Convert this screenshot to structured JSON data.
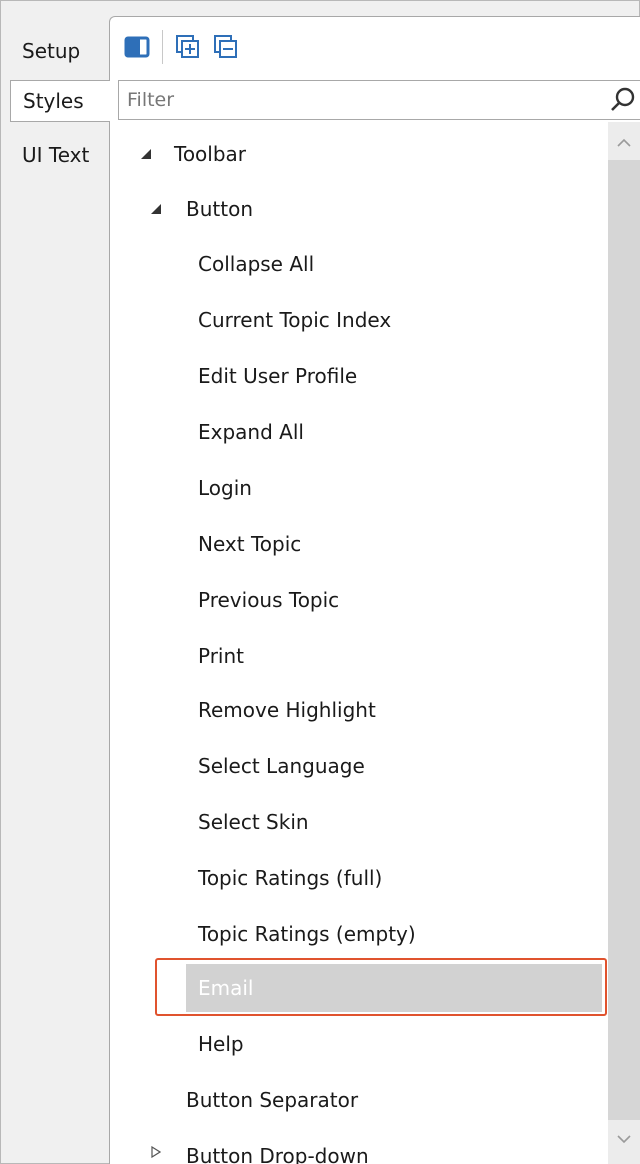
{
  "tabs": {
    "setup": "Setup",
    "styles": "Styles",
    "ui_text": "UI Text"
  },
  "toolbar": {
    "icons": [
      "panel-toggle-icon",
      "expand-all-icon",
      "collapse-all-icon"
    ]
  },
  "filter": {
    "placeholder": "Filter"
  },
  "tree": {
    "toolbar": "Toolbar",
    "button": "Button",
    "items": [
      "Collapse All",
      "Current Topic Index",
      "Edit User Profile",
      "Expand All",
      "Login",
      "Next Topic",
      "Previous Topic",
      "Print",
      "Remove Highlight",
      "Select Language",
      "Select Skin",
      "Topic Ratings (full)",
      "Topic Ratings (empty)",
      "Email",
      "Help"
    ],
    "button_separator": "Button Separator",
    "button_dropdown": "Button Drop-down"
  },
  "colors": {
    "selection": "#d2d2d2",
    "highlight_border": "#e0532e",
    "toolbar_icon": "#2e6fb8"
  }
}
